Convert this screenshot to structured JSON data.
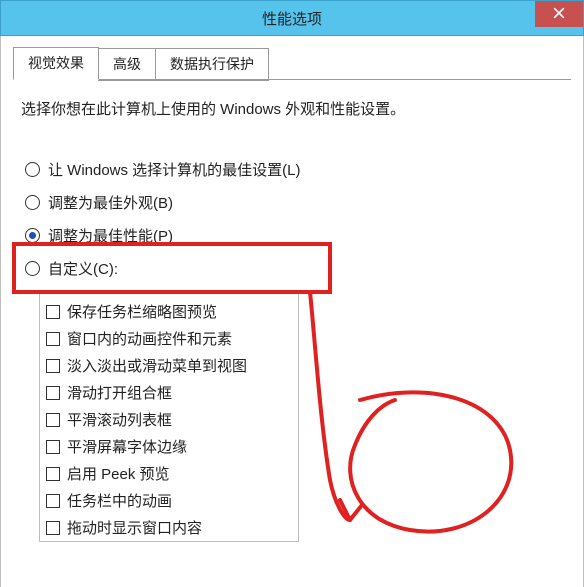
{
  "window": {
    "title": "性能选项"
  },
  "tabs": {
    "visual": "视觉效果",
    "advanced": "高级",
    "dep": "数据执行保护"
  },
  "intro": "选择你想在此计算机上使用的 Windows 外观和性能设置。",
  "radios": {
    "let_windows": "让 Windows 选择计算机的最佳设置(L)",
    "best_appearance": "调整为最佳外观(B)",
    "best_performance": "调整为最佳性能(P)",
    "custom": "自定义(C):"
  },
  "checkboxes": [
    "保存任务栏缩略图预览",
    "窗口内的动画控件和元素",
    "淡入淡出或滑动菜单到视图",
    "滑动打开组合框",
    "平滑滚动列表框",
    "平滑屏幕字体边缘",
    "启用 Peek 预览",
    "任务栏中的动画",
    "拖动时显示窗口内容"
  ],
  "annotation": {
    "color": "#e12020"
  }
}
